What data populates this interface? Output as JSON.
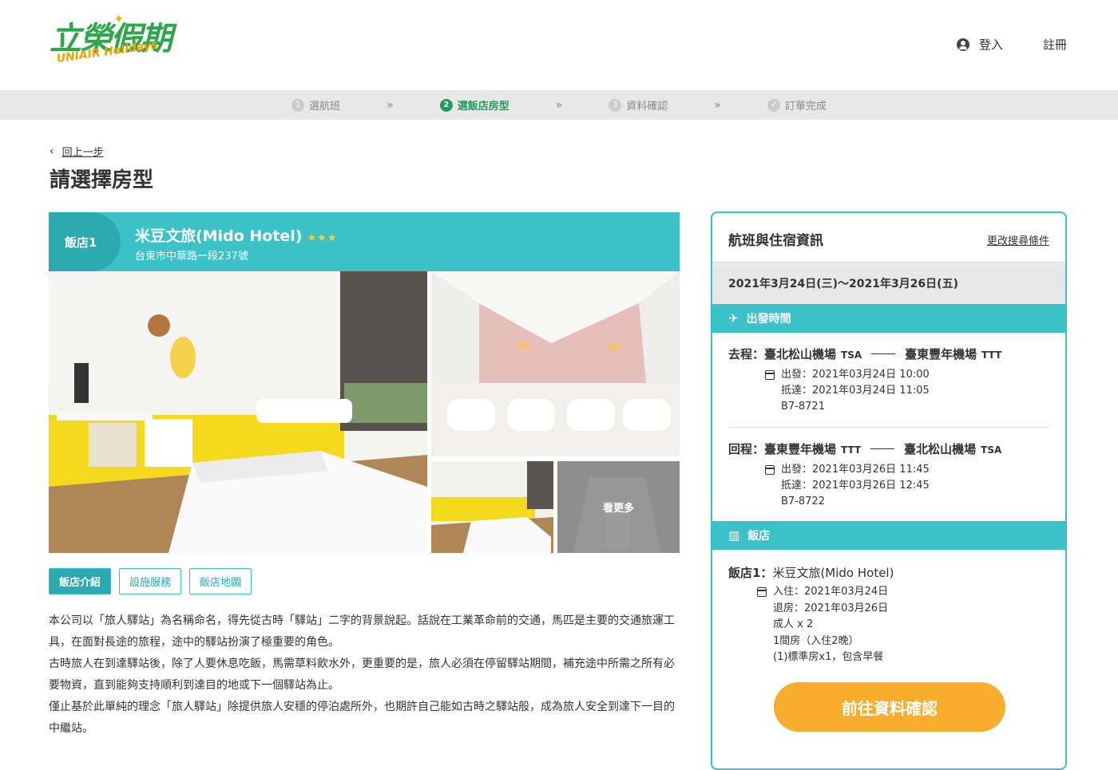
{
  "brand": {
    "name_cn": "立榮假期",
    "name_en": "UNIAIR Holidays"
  },
  "header": {
    "login": "登入",
    "register": "註冊"
  },
  "steps": [
    {
      "num": "1",
      "label": "選航班"
    },
    {
      "num": "2",
      "label": "選飯店房型"
    },
    {
      "num": "3",
      "label": "資料確認"
    },
    {
      "num": "✓",
      "label": "訂單完成"
    }
  ],
  "step_sep": "»",
  "back": {
    "label": "回上一步"
  },
  "page_title": "請選擇房型",
  "hotel": {
    "badge": "飯店1",
    "name": "米豆文旅(Mido Hotel)",
    "stars": "★★★",
    "address": "台東市中華路一段237號",
    "more_photos": "看更多"
  },
  "tabs": [
    "飯店介紹",
    "設施服務",
    "飯店地圖"
  ],
  "description": [
    "本公司以「旅人驛站」為名稱命名，得先從古時「驛站」二字的背景說起。話說在工業革命前的交通，馬匹是主要的交通旅運工具，在面對長途的旅程，途中的驛站扮演了極重要的角色。",
    "古時旅人在到達驛站後，除了人要休息吃飯，馬需草料飲水外，更重要的是，旅人必須在停留驛站期間，補充途中所需之所有必要物資，直到能夠支持順利到達目的地或下一個驛站為止。",
    "僅止基於此單純的理念「旅人驛站」除提供旅人安穩的停泊處所外，也期許自己能如古時之驛站般，成為旅人安全到達下一目的中繼站。"
  ],
  "sidebar": {
    "title": "航班與住宿資訊",
    "edit": "更改搜尋條件",
    "dates": "2021年3月24日(三)～2021年3月26日(五)",
    "flight_section": "出發時間",
    "flights": [
      {
        "label": "去程：",
        "from": "臺北松山機場",
        "from_code": "TSA",
        "to": "臺東豐年機場",
        "to_code": "TTT",
        "depart": "出發：2021年03月24日 10:00",
        "arrive": "抵達：2021年03月24日 11:05",
        "flight_no": "B7-8721"
      },
      {
        "label": "回程：",
        "from": "臺東豐年機場",
        "from_code": "TTT",
        "to": "臺北松山機場",
        "to_code": "TSA",
        "depart": "出發：2021年03月26日 11:45",
        "arrive": "抵達：2021年03月26日 12:45",
        "flight_no": "B7-8722"
      }
    ],
    "hotel_section": "飯店",
    "hotel_label": "飯店1：",
    "hotel_name": "米豆文旅(Mido Hotel)",
    "checkin": "入住：2021年03月24日",
    "checkout": "退房：2021年03月26日",
    "guests": "成人 x 2",
    "rooms": "1間房（入住2晚）",
    "room_type": "(1)標準房x1，包含早餐",
    "cta": "前往資料確認"
  },
  "colors": {
    "teal": "#3ac2c8",
    "green": "#1e9e5c",
    "orange": "#f9ad2c",
    "yellow": "#f7d23e"
  }
}
